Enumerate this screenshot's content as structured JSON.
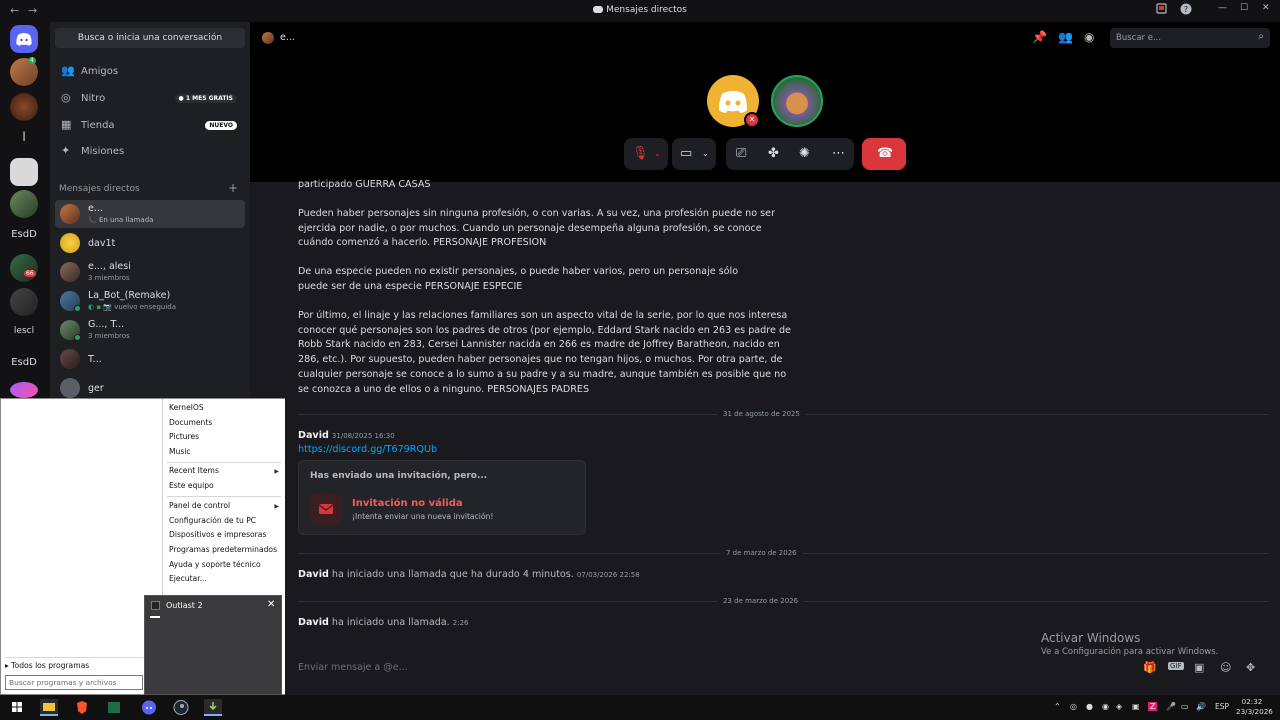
{
  "window": {
    "title": "Mensajes directos",
    "nav_back": "←",
    "nav_forward": "→",
    "controls": {
      "minimize": "—",
      "maximize": "☐",
      "close": "✕"
    }
  },
  "rail": {
    "items": [
      {
        "label": "l"
      },
      {
        "label": "EsdD"
      },
      {
        "label": "lescl"
      },
      {
        "label": "EsdD"
      }
    ],
    "badges": {
      "avatar_badge": "4",
      "count_badge": "66"
    }
  },
  "sidebar": {
    "search_label": "Busca o inicia una conversación",
    "nav": [
      {
        "label": "Amigos",
        "icon": "friends-icon"
      },
      {
        "label": "Nitro",
        "icon": "nitro-icon",
        "pill": "1 MES GRATIS"
      },
      {
        "label": "Tienda",
        "icon": "shop-icon",
        "pill": "NUEVO"
      },
      {
        "label": "Misiones",
        "icon": "quests-icon"
      }
    ],
    "dm_header": "Mensajes directos",
    "dm_add": "+",
    "dms": [
      {
        "name": "e...",
        "sub": "En una llamada"
      },
      {
        "name": "dav1t",
        "sub": ""
      },
      {
        "name": "e..., alesi",
        "sub": "3 miembros"
      },
      {
        "name": "La_Bot_(Remake)",
        "sub": "vuelvo enseguida"
      },
      {
        "name": "G..., T...",
        "sub": "3 miembros"
      },
      {
        "name": "T...",
        "sub": ""
      },
      {
        "name": "ger",
        "sub": ""
      }
    ]
  },
  "call": {
    "channel_name": "e...",
    "search_placeholder": "Buscar e..."
  },
  "chat": {
    "paragraphs": [
      "participado GUERRA CASAS",
      "Pueden haber personajes sin ninguna profesión, o con varias. A su vez, una profesión puede no ser ejercida por nadie, o por muchos. Cuando un personaje desempeña alguna profesión, se conoce cuándo comenzó a hacerlo. PERSONAJE PROFESION",
      "De una especie pueden no existir personajes, o puede haber varios, pero un personaje sólo puede ser de una especie PERSONAJE ESPECIE",
      "Por último, el linaje y las relaciones familiares son un aspecto vital de la serie, por lo que nos interesa conocer qué personajes son los padres de otros (por ejemplo, Eddard Stark nacido en 263 es padre de Robb Stark nacido en 283, Cersei Lannister nacida en 266 es madre de Joffrey Baratheon, nacido en 286, etc.). Por supuesto, pueden haber personajes que no tengan hijos, o muchos. Por otra parte, de cualquier personaje se conoce a lo sumo a su padre y a su madre, aunque también es posible que no se conozca a uno de ellos o a ninguno. PERSONAJES PADRES"
    ],
    "dividers": [
      "31 de agosto de 2025",
      "7 de marzo de 2026",
      "23 de marzo de 2026"
    ],
    "msg1": {
      "author": "David",
      "time": "31/08/2025 16:30",
      "link": "https://discord.gg/T679RQUb"
    },
    "invite": {
      "heading": "Has enviado una invitación, pero...",
      "title": "Invitación no válida",
      "subtitle": "¡Intenta enviar una nueva invitación!"
    },
    "msg2": {
      "author": "David",
      "text": "ha iniciado una llamada que ha durado 4 minutos.",
      "time": "07/03/2026 22:58"
    },
    "msg3": {
      "author": "David",
      "text": "ha iniciado una llamada.",
      "time": "2:26"
    },
    "composer_placeholder": "Enviar mensaje a @e..."
  },
  "start_menu": {
    "right_items": [
      "KernelOS",
      "Documents",
      "Pictures",
      "Music",
      "Recent Items",
      "Este equipo",
      "Panel de control",
      "Configuración de tu PC",
      "Dispositivos e impresoras",
      "Programas predeterminados",
      "Ayuda y soporte técnico",
      "Ejecutar..."
    ],
    "all_programs": "Todos los programas",
    "search_placeholder": "Buscar programas y archivos"
  },
  "thumbnail": {
    "title": "Outlast 2"
  },
  "activation": {
    "title": "Activar Windows",
    "subtitle": "Ve a Configuración para activar Windows."
  },
  "taskbar": {
    "lang": "ESP",
    "time": "02:32",
    "date": "23/3/2026"
  },
  "colors": {
    "blurple": "#5865f2",
    "danger": "#da373c",
    "online": "#23a55a",
    "link": "#00a8fc"
  }
}
